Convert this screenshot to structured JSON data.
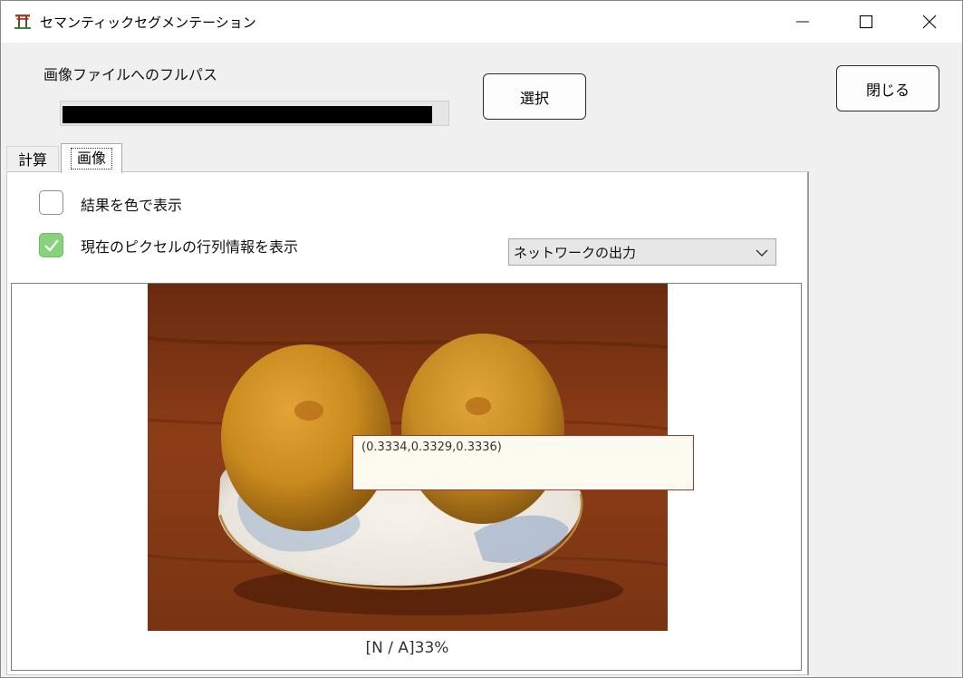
{
  "window": {
    "title": "セマンティックセグメンテーション",
    "icon": "torii-icon"
  },
  "file": {
    "path_label": "画像ファイルへのフルパス",
    "path_value": ""
  },
  "buttons": {
    "select": "選択",
    "close": "閉じる"
  },
  "tabs": [
    {
      "label": "計算",
      "active": false
    },
    {
      "label": "画像",
      "active": true
    }
  ],
  "options": {
    "color_result_label": "結果を色で表示",
    "color_result_checked": false,
    "pixel_info_label": "現在のピクセルの行列情報を表示",
    "pixel_info_checked": true
  },
  "output_select": {
    "value": "ネットワークの出力"
  },
  "viewer": {
    "pixel_values": "(0.3334,0.3329,0.3336)",
    "status": "[N / A]33%"
  },
  "colors": {
    "accent_check": "#87d37c",
    "tooltip_border": "#a03a2f"
  }
}
